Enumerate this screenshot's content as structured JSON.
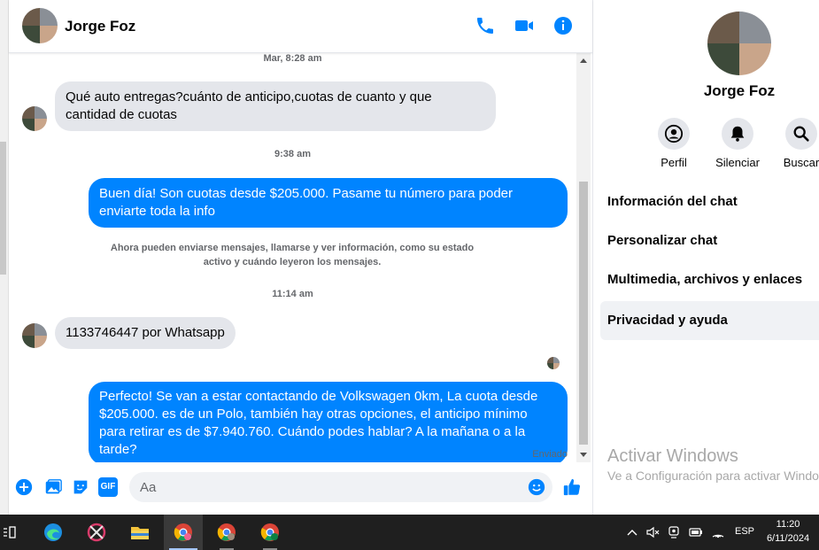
{
  "header": {
    "contact_name": "Jorge Foz",
    "call_icon": "phone-icon",
    "video_icon": "video-icon",
    "info_icon": "info-icon"
  },
  "messages": {
    "ts1": "Mar, 8:28 am",
    "msg1": "Qué auto entregas?cuánto de anticipo,cuotas de cuanto y que cantidad de cuotas",
    "ts2": "9:38 am",
    "msg2": "Buen día! Son cuotas desde $205.000. Pasame tu número para poder enviarte toda la info",
    "system_notice": "Ahora pueden enviarse mensajes, llamarse y ver información, como su estado activo y cuándo leyeron los mensajes.",
    "ts3": "11:14 am",
    "msg3": "1133746447 por Whatsapp",
    "msg4": "Perfecto!  Se van a estar contactando de Volkswagen 0km, La cuota desde $205.000. es de un Polo, también hay otras opciones, el anticipo mínimo para retirar es de $7.940.760. Cuándo podes hablar? A la mañana o a la tarde?",
    "status": "Enviado"
  },
  "composer": {
    "placeholder": "Aa",
    "icons": [
      "add-icon",
      "image-icon",
      "sticker-icon",
      "gif-icon",
      "emoji-icon",
      "thumbs-up-icon"
    ],
    "gif_label": "GIF"
  },
  "info_panel": {
    "name": "Jorge Foz",
    "actions": [
      {
        "label": "Perfil",
        "icon": "profile-icon"
      },
      {
        "label": "Silenciar",
        "icon": "bell-icon"
      },
      {
        "label": "Buscar",
        "icon": "search-icon"
      }
    ],
    "menu": [
      {
        "label": "Información del chat"
      },
      {
        "label": "Personalizar chat"
      },
      {
        "label": "Multimedia, archivos y enlaces"
      },
      {
        "label": "Privacidad y ayuda"
      }
    ],
    "watermark_title": "Activar Windows",
    "watermark_sub": "Ve a Configuración para activar Windows."
  },
  "taskbar": {
    "language": "ESP",
    "time": "11:20",
    "date": "6/11/2024"
  },
  "colors": {
    "accent": "#0084ff",
    "incoming_bubble": "#e4e6eb",
    "taskbar": "#1f1f1f"
  }
}
